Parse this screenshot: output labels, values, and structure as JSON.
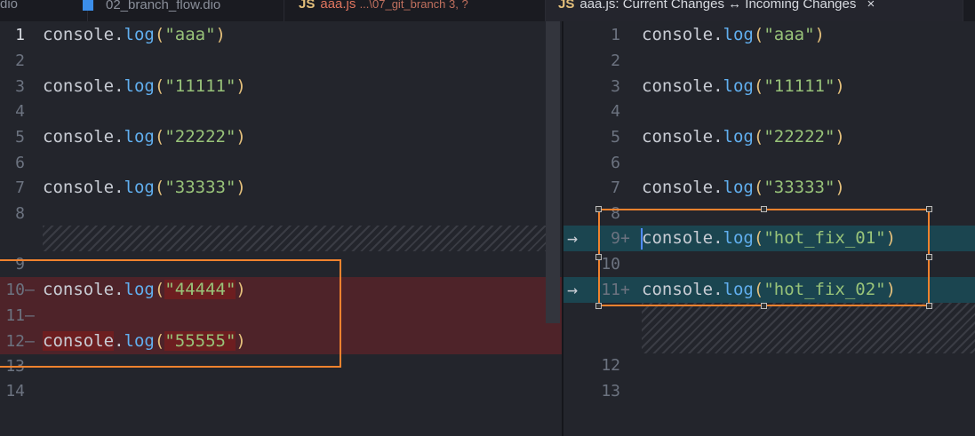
{
  "tabs": [
    {
      "label": "dio",
      "icon": "file-icon"
    },
    {
      "label": "02_branch_flow.dio",
      "icon": "drawio-icon"
    },
    {
      "label": "aaa.js",
      "detail": "...\\07_git_branch 3, ?",
      "icon": "js-icon"
    },
    {
      "label": "aaa.js: Current Changes ↔ Incoming Changes",
      "icon": "js-icon",
      "close": "×"
    }
  ],
  "js_icon": "JS",
  "left": {
    "lines": [
      {
        "n": "1",
        "fn": "log",
        "arg": "\"aaa\""
      },
      {
        "n": "2"
      },
      {
        "n": "3",
        "fn": "log",
        "arg": "\"11111\""
      },
      {
        "n": "4"
      },
      {
        "n": "5",
        "fn": "log",
        "arg": "\"22222\""
      },
      {
        "n": "6"
      },
      {
        "n": "7",
        "fn": "log",
        "arg": "\"33333\""
      },
      {
        "n": "8"
      },
      {
        "n": "9"
      },
      {
        "n": "10",
        "mark": "—",
        "fn": "log",
        "arg": "\"44444\""
      },
      {
        "n": "11",
        "mark": "—"
      },
      {
        "n": "12",
        "mark": "—",
        "fn": "log",
        "arg": "\"55555\""
      },
      {
        "n": "13"
      },
      {
        "n": "14"
      }
    ]
  },
  "right": {
    "lines": [
      {
        "n": "1",
        "fn": "log",
        "arg": "\"aaa\""
      },
      {
        "n": "2"
      },
      {
        "n": "3",
        "fn": "log",
        "arg": "\"11111\""
      },
      {
        "n": "4"
      },
      {
        "n": "5",
        "fn": "log",
        "arg": "\"22222\""
      },
      {
        "n": "6"
      },
      {
        "n": "7",
        "fn": "log",
        "arg": "\"33333\""
      },
      {
        "n": "8"
      },
      {
        "n": "9",
        "mark": "+",
        "fn": "log",
        "arg": "\"hot_fix_01\"",
        "arrow": "→"
      },
      {
        "n": "10"
      },
      {
        "n": "11",
        "mark": "+",
        "fn": "log",
        "arg": "\"hot_fix_02\"",
        "arrow": "→"
      },
      {
        "n": "12"
      },
      {
        "n": "13"
      }
    ]
  },
  "obj": "console",
  "dot": ".",
  "open": "(",
  "close": ")"
}
